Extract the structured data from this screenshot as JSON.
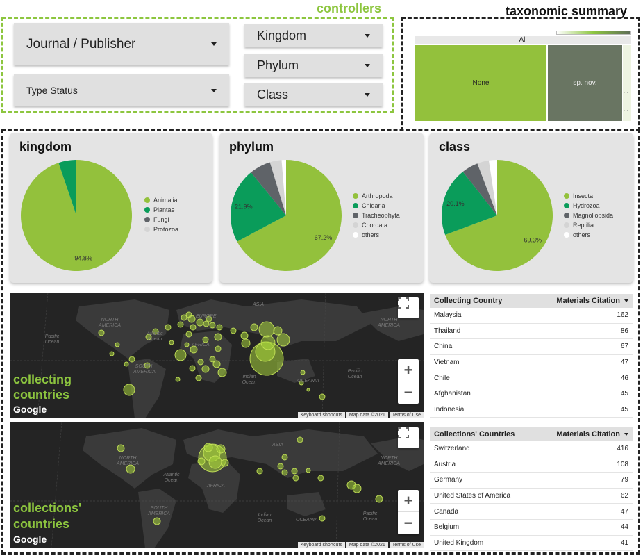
{
  "controllers": {
    "title": "controllers",
    "journal_publisher": "Journal / Publisher",
    "type_status": "Type Status",
    "kingdom": "Kingdom",
    "phylum": "Phylum",
    "class": "Class"
  },
  "taxonomic_summary": {
    "title": "taxonomic summary",
    "root": "All",
    "cells": [
      "None",
      "sp. nov."
    ],
    "more": "..."
  },
  "pies": {
    "kingdom": {
      "title": "kingdom",
      "slices": [
        {
          "name": "Animalia",
          "value": 94.8,
          "color": "#93c13c",
          "label": "94.8%"
        },
        {
          "name": "Plantae",
          "value": 5.0,
          "color": "#0a9c5a",
          "label": ""
        },
        {
          "name": "Fungi",
          "value": 0.15,
          "color": "#5f6368",
          "label": ""
        },
        {
          "name": "Protozoa",
          "value": 0.05,
          "color": "#d4d4d4",
          "label": ""
        }
      ]
    },
    "phylum": {
      "title": "phylum",
      "slices": [
        {
          "name": "Arthropoda",
          "value": 67.2,
          "color": "#93c13c",
          "label": "67.2%"
        },
        {
          "name": "Cnidaria",
          "value": 21.9,
          "color": "#0a9c5a",
          "label": "21.9%"
        },
        {
          "name": "Tracheophyta",
          "value": 6.2,
          "color": "#5f6368",
          "label": ""
        },
        {
          "name": "Chordata",
          "value": 3.4,
          "color": "#d4d4d4",
          "label": ""
        },
        {
          "name": "others",
          "value": 1.3,
          "color": "#ffffff",
          "label": ""
        }
      ]
    },
    "class": {
      "title": "class",
      "slices": [
        {
          "name": "Insecta",
          "value": 69.3,
          "color": "#93c13c",
          "label": "69.3%"
        },
        {
          "name": "Hydrozoa",
          "value": 20.1,
          "color": "#0a9c5a",
          "label": "20.1%"
        },
        {
          "name": "Magnoliopsida",
          "value": 4.8,
          "color": "#5f6368",
          "label": ""
        },
        {
          "name": "Reptilia",
          "value": 3.4,
          "color": "#d4d4d4",
          "label": ""
        },
        {
          "name": "others",
          "value": 2.4,
          "color": "#ffffff",
          "label": ""
        }
      ]
    }
  },
  "maps": {
    "collecting": {
      "title_line1": "collecting",
      "title_line2": "countries",
      "logo": "Google",
      "footer": [
        "Keyboard shortcuts",
        "Map data ©2021",
        "Terms of Use"
      ],
      "labels": [
        "ASIA",
        "NORTH AMERICA",
        "EUROPE",
        "AFRICA",
        "SOUTH AMERICA",
        "Atlantic Ocean",
        "Indian Ocean",
        "OCEANIA",
        "Pacific Ocean",
        "NORTH AMERICA",
        "Pacific Ocean"
      ]
    },
    "collections": {
      "title_line1": "collections'",
      "title_line2": "countries",
      "logo": "Google",
      "footer": [
        "Keyboard shortcuts",
        "Map data ©2021",
        "Terms of Use"
      ],
      "labels": [
        "ASIA",
        "NORTH AMERICA",
        "Atlantic Ocean",
        "AFRICA",
        "SOUTH AMERICA",
        "Indian Ocean",
        "OCEANIA",
        "NORTH AMERICA",
        "Pacific Ocean"
      ]
    }
  },
  "tables": {
    "collecting": {
      "col1": "Collecting Country",
      "col2": "Materials Citation",
      "rows": [
        {
          "country": "Malaysia",
          "value": "162"
        },
        {
          "country": "Thailand",
          "value": "86"
        },
        {
          "country": "China",
          "value": "67"
        },
        {
          "country": "Vietnam",
          "value": "47"
        },
        {
          "country": "Chile",
          "value": "46"
        },
        {
          "country": "Afghanistan",
          "value": "45"
        },
        {
          "country": "Indonesia",
          "value": "45"
        }
      ]
    },
    "collections": {
      "col1": "Collections' Countries",
      "col2": "Materials Citation",
      "rows": [
        {
          "country": "Switzerland",
          "value": "416"
        },
        {
          "country": "Austria",
          "value": "108"
        },
        {
          "country": "Germany",
          "value": "79"
        },
        {
          "country": "United States of America",
          "value": "62"
        },
        {
          "country": "Canada",
          "value": "47"
        },
        {
          "country": "Belgium",
          "value": "44"
        },
        {
          "country": "United Kingdom",
          "value": "41"
        }
      ]
    }
  },
  "colors": {
    "accent": "#8dc63f",
    "map_bg": "#242424",
    "land": "#3a3a3a",
    "bubble": "#a6d23a"
  }
}
